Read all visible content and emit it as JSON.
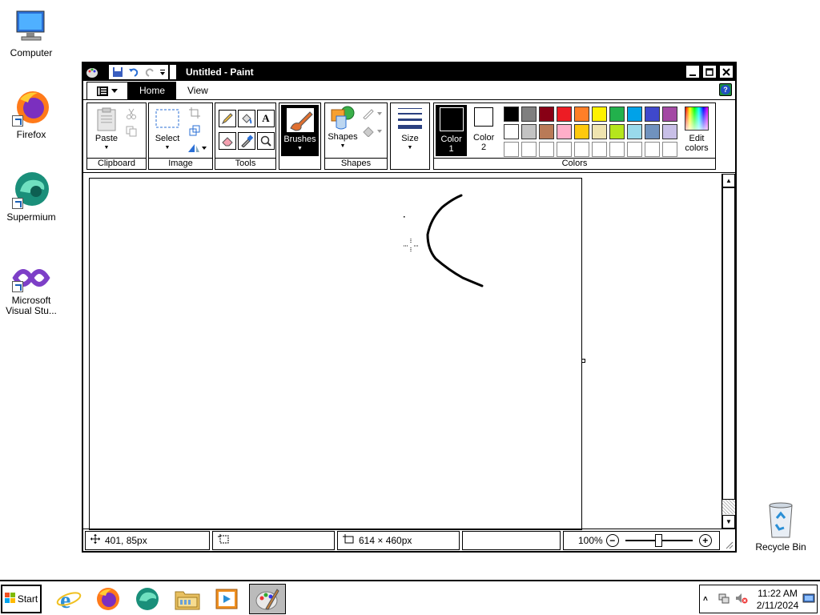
{
  "desktop": {
    "icons": [
      {
        "label": "Computer"
      },
      {
        "label": "Firefox"
      },
      {
        "label": "Supermium"
      },
      {
        "label": "Microsoft Visual Stu..."
      },
      {
        "label": "Recycle Bin"
      }
    ]
  },
  "window": {
    "title": "Untitled - Paint",
    "tabs": [
      "Home",
      "View"
    ],
    "ribbon": {
      "clipboard": {
        "paste": "Paste",
        "group": "Clipboard"
      },
      "image": {
        "select": "Select",
        "group": "Image"
      },
      "tools": {
        "group": "Tools",
        "text_tool": "A"
      },
      "brushes": {
        "label": "Brushes"
      },
      "shapes": {
        "label": "Shapes",
        "group": "Shapes"
      },
      "size": {
        "label": "Size"
      },
      "colors": {
        "color1": "Color 1",
        "color2": "Color 2",
        "edit": "Edit colors",
        "group": "Colors",
        "palette_row1": [
          "#000000",
          "#7f7f7f",
          "#880015",
          "#ed1c24",
          "#ff7f27",
          "#fff200",
          "#22b14c",
          "#00a2e8",
          "#3f48cc",
          "#a349a4"
        ],
        "palette_row2": [
          "#ffffff",
          "#c3c3c3",
          "#b97a57",
          "#ffaec9",
          "#ffc90e",
          "#efe4b0",
          "#b5e61d",
          "#99d9ea",
          "#7092be",
          "#c8bfe7"
        ]
      }
    },
    "status": {
      "cursor_pos": "401, 85px",
      "selection_size": "",
      "image_size": "614 × 460px",
      "zoom": "100%"
    }
  },
  "taskbar": {
    "start": "Start",
    "time": "11:22 AM",
    "date": "2/11/2024"
  }
}
